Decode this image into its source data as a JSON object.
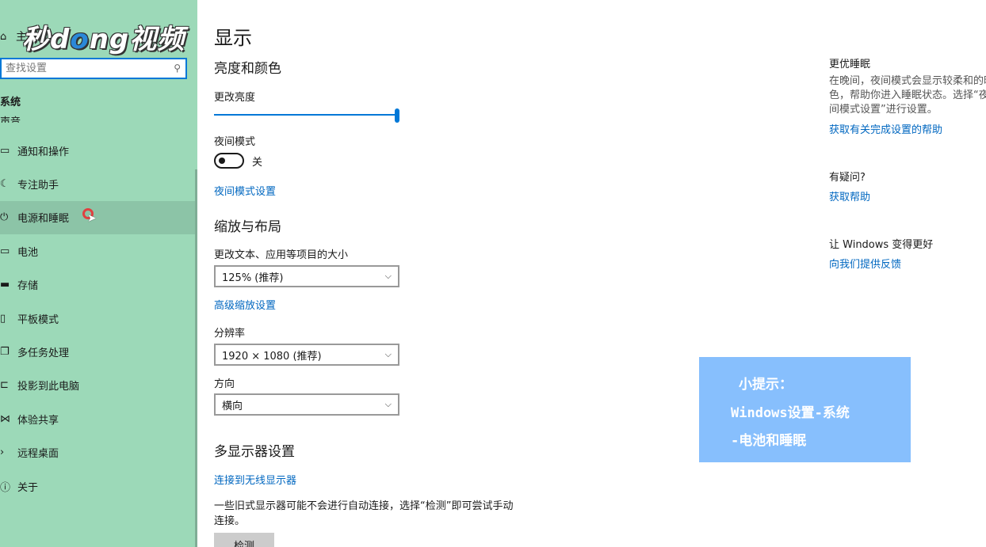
{
  "sidebar": {
    "home_label": "主页",
    "logo_text_a": "秒d",
    "logo_text_o": "o",
    "logo_text_b": "ng视频",
    "search_placeholder": "查找设置",
    "section_label": "系统",
    "cut_item": "声音",
    "items": [
      {
        "label": "通知和操作",
        "icon": "chat-icon"
      },
      {
        "label": "专注助手",
        "icon": "moon-icon"
      },
      {
        "label": "电源和睡眠",
        "icon": "power-icon"
      },
      {
        "label": "电池",
        "icon": "battery-icon"
      },
      {
        "label": "存储",
        "icon": "storage-icon"
      },
      {
        "label": "平板模式",
        "icon": "tablet-icon"
      },
      {
        "label": "多任务处理",
        "icon": "multitask-icon"
      },
      {
        "label": "投影到此电脑",
        "icon": "project-icon"
      },
      {
        "label": "体验共享",
        "icon": "share-icon"
      },
      {
        "label": "远程桌面",
        "icon": "remote-icon"
      },
      {
        "label": "关于",
        "icon": "info-icon"
      }
    ]
  },
  "main": {
    "title": "显示",
    "brightness_heading": "亮度和颜色",
    "brightness_label": "更改亮度",
    "brightness_level": 1.0,
    "night_mode_label": "夜间模式",
    "night_mode_state": "关",
    "night_mode_link": "夜间模式设置",
    "scale_heading": "缩放与布局",
    "scale_label": "更改文本、应用等项目的大小",
    "scale_value": "125% (推荐)",
    "advanced_scale_link": "高级缩放设置",
    "resolution_label": "分辨率",
    "resolution_value": "1920 × 1080 (推荐)",
    "orientation_label": "方向",
    "orientation_value": "横向",
    "multi_heading": "多显示器设置",
    "wireless_link": "连接到无线显示器",
    "multi_desc": "一些旧式显示器可能不会进行自动连接，选择“检测”即可尝试手动连接。",
    "detect_button": "检测"
  },
  "right": {
    "sleep_heading": "更优睡眠",
    "sleep_desc": "在晚间，夜间模式会显示较柔和的暖色，帮助你进入睡眠状态。选择“夜间模式设置”进行设置。",
    "sleep_link": "获取有关完成设置的帮助",
    "question_heading": "有疑问?",
    "help_link": "获取帮助",
    "improve_heading": "让 Windows 变得更好",
    "feedback_link": "向我们提供反馈"
  },
  "tip": {
    "line1": "小提示：",
    "line2": "Windows设置-系统",
    "line3": "-电池和睡眠"
  },
  "colors": {
    "sidebar_bg": "#9cd9b8",
    "accent": "#0078d7",
    "link": "#0067c0",
    "tip_bg": "#87bffd"
  }
}
